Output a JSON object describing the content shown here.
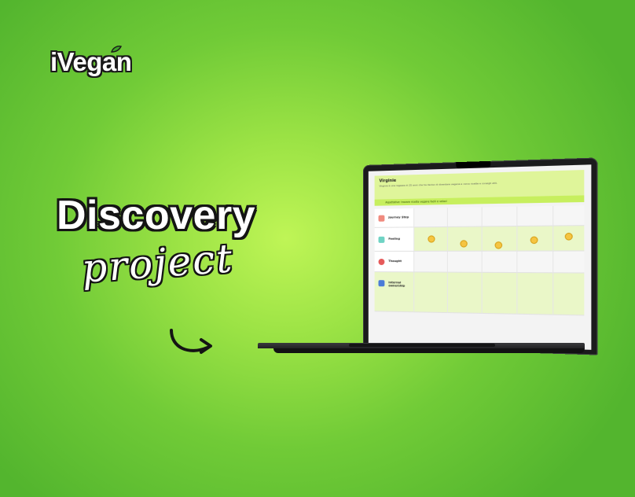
{
  "brand": {
    "logo_text": "iVegan",
    "accent": "#2f7d1e"
  },
  "hero": {
    "title": "Discovery",
    "subtitle": "project"
  },
  "colors": {
    "bg_light": "#bff556",
    "bg_dark": "#53b52e",
    "outline": "#141414"
  },
  "journey_map": {
    "title": "Virginie",
    "description": "Virginie è una ragazza di 25 anni che ha deciso di diventare vegana e cerca ricette e consigli utili.",
    "bar_text": "Aspettative: trovare ricette vegane facili e veloci",
    "rows": [
      {
        "label": "Journey Step",
        "icon": "steps-icon"
      },
      {
        "label": "Feeling",
        "icon": "feeling-icon"
      },
      {
        "label": "Thought",
        "icon": "thought-icon"
      },
      {
        "label": "Internal ownership",
        "icon": "ownership-icon"
      }
    ],
    "columns": 5
  }
}
